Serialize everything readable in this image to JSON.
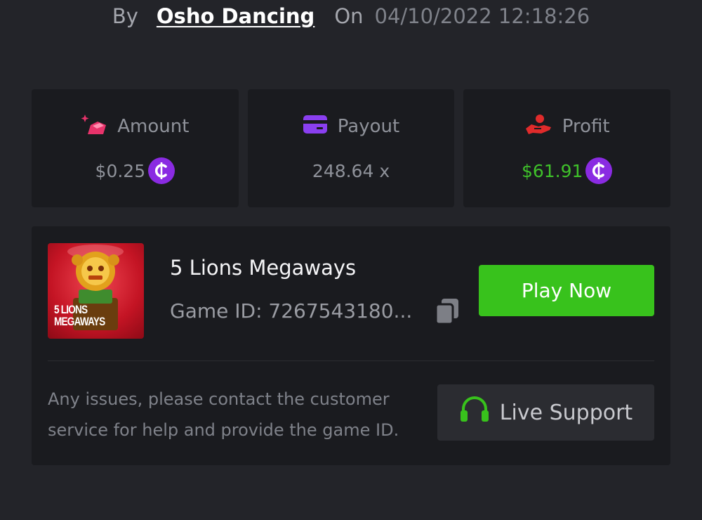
{
  "byline": {
    "by_label": "By",
    "username": "Osho Dancing",
    "on_label": "On",
    "datetime": "04/10/2022 12:18:26"
  },
  "stats": {
    "amount": {
      "label": "Amount",
      "value": "$0.25",
      "icon": "bet-amount-icon",
      "color": "#e8336b"
    },
    "payout": {
      "label": "Payout",
      "value": "248.64 x",
      "icon": "card-icon",
      "color": "#8a3ff0"
    },
    "profit": {
      "label": "Profit",
      "value": "$61.91",
      "icon": "hand-profit-icon",
      "color": "#e02b2b",
      "value_color": "#3fc12a"
    }
  },
  "currency": {
    "symbol": "₵",
    "color": "#8a2be2"
  },
  "game": {
    "thumbnail_text_line1": "5 LIONS",
    "thumbnail_text_line2": "MEGAWAYS",
    "title": "5 Lions Megaways",
    "id_text": "Game ID: 7267543180...",
    "play_label": "Play Now",
    "play_color": "#38c21c"
  },
  "support": {
    "help_text": "Any issues, please contact the customer service for help and provide the game ID.",
    "button_label": "Live Support",
    "icon": "headset-icon",
    "icon_color": "#38c21c"
  }
}
